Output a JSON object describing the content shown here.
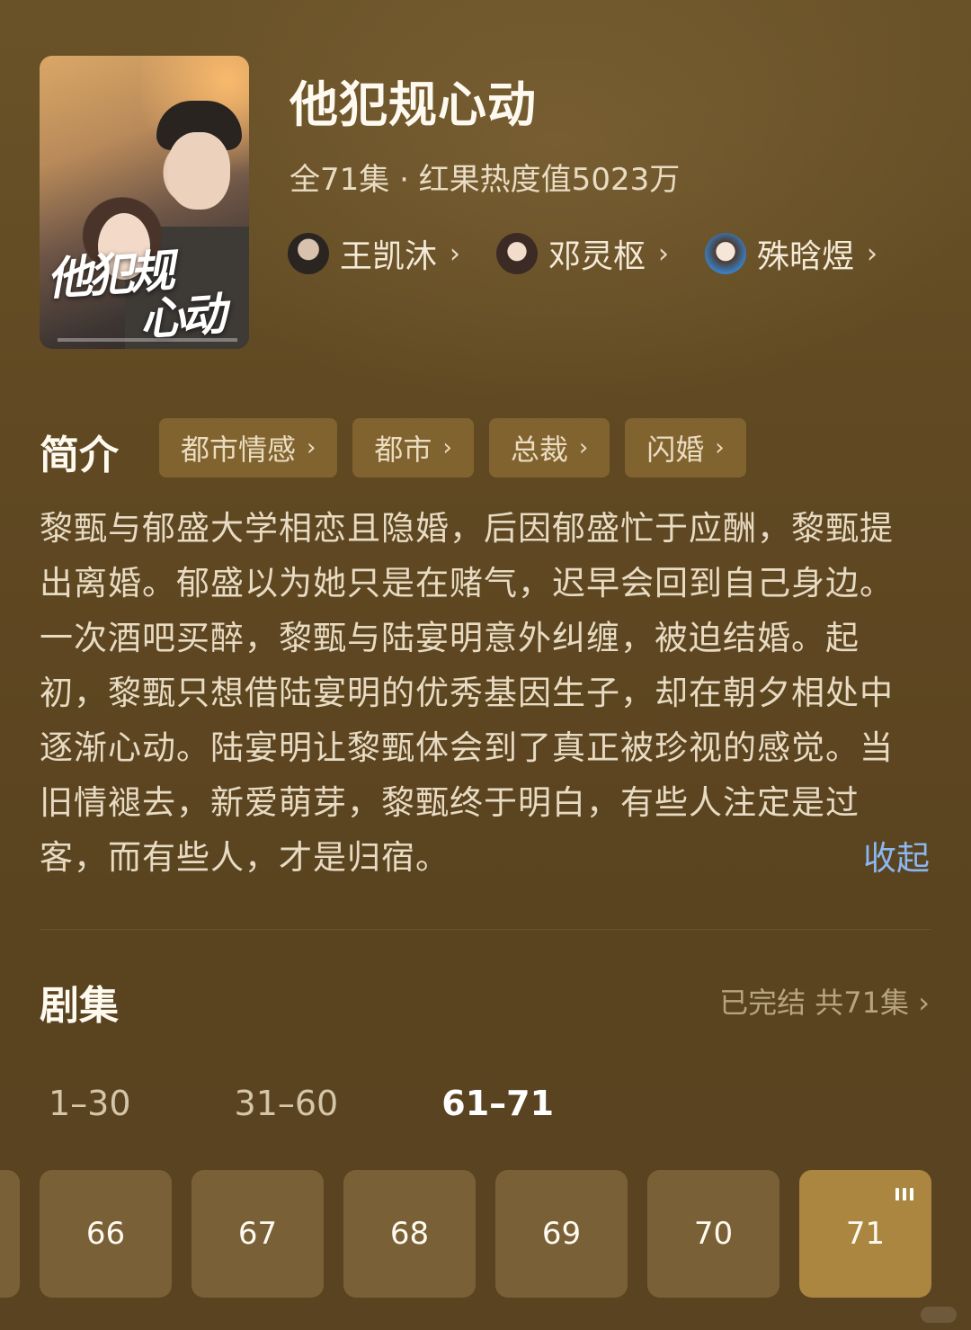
{
  "show": {
    "title": "他犯规心动",
    "meta": "全71集 · 红果热度值5023万",
    "poster_title_line1": "他犯规",
    "poster_title_line2": "心动"
  },
  "cast": [
    {
      "name": "王凯沐",
      "avatar_icon": "male-actor-avatar"
    },
    {
      "name": "邓灵枢",
      "avatar_icon": "female-actor-avatar"
    },
    {
      "name": "殊晗煜",
      "avatar_icon": "female-actor-avatar"
    }
  ],
  "intro": {
    "label": "简介",
    "tags": [
      "都市情感",
      "都市",
      "总裁",
      "闪婚"
    ],
    "lines": [
      "黎甄与郁盛大学相恋且隐婚，后因郁盛忙于应酬，黎甄提",
      "出离婚。郁盛以为她只是在赌气，迟早会回到自己身边。",
      "一次酒吧买醉，黎甄与陆宴明意外纠缠，被迫结婚。起",
      "初，黎甄只想借陆宴明的优秀基因生子，却在朝夕相处中",
      "逐渐心动。陆宴明让黎甄体会到了真正被珍视的感觉。当",
      "旧情褪去，新爱萌芽，黎甄终于明白，有些人注定是过",
      "客，而有些人，才是归宿。"
    ],
    "collapse_label": "收起"
  },
  "episodes": {
    "label": "剧集",
    "status": "已完结 共71集",
    "ranges": [
      "1–30",
      "31–60",
      "61–71"
    ],
    "active_range": "61–71",
    "cards": [
      "66",
      "67",
      "68",
      "69",
      "70",
      "71"
    ],
    "playing_episode": "71"
  },
  "colors": {
    "background": "#5f4822",
    "tag_bg": "#81632f",
    "card_bg": "#7a6036",
    "active_card_bg": "#ab8640",
    "link": "#8bb7f0"
  }
}
